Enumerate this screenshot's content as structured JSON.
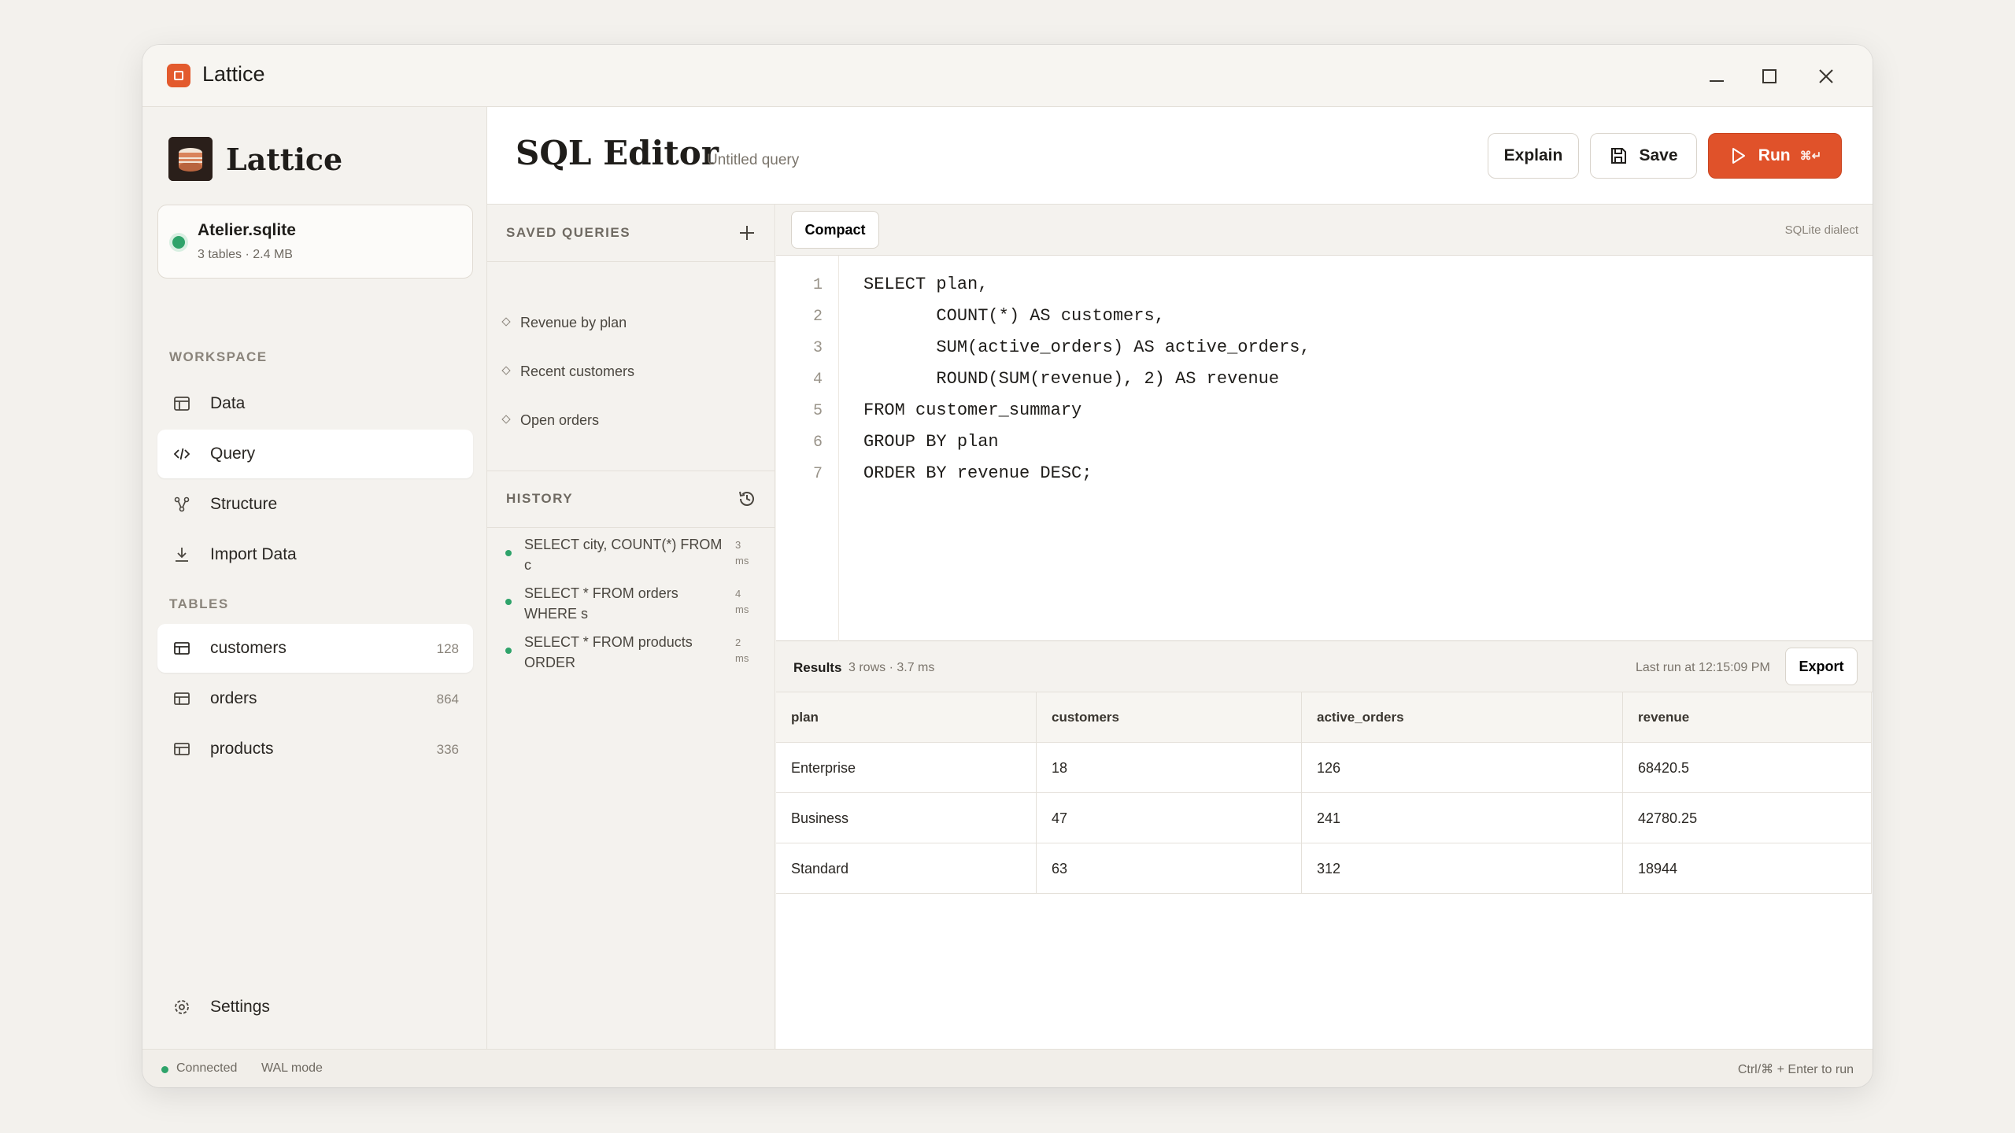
{
  "window": {
    "title": "Lattice"
  },
  "sidebar": {
    "brand": "Lattice",
    "database": {
      "name": "Atelier.sqlite",
      "meta": "3 tables · 2.4 MB"
    },
    "workspace_label": "WORKSPACE",
    "workspace_items": [
      {
        "label": "Data",
        "icon": "table-icon"
      },
      {
        "label": "Query",
        "icon": "code-icon",
        "active": true
      },
      {
        "label": "Structure",
        "icon": "schema-icon"
      },
      {
        "label": "Import Data",
        "icon": "download-icon"
      }
    ],
    "tables_label": "TABLES",
    "tables": [
      {
        "label": "customers",
        "count": "128"
      },
      {
        "label": "orders",
        "count": "864"
      },
      {
        "label": "products",
        "count": "336"
      }
    ],
    "settings_label": "Settings"
  },
  "header": {
    "title": "SQL Editor",
    "subtitle": "Untitled query",
    "explain_label": "Explain",
    "save_label": "Save",
    "run_label": "Run",
    "run_shortcut": "⌘↵"
  },
  "saved_queries": {
    "label": "SAVED QUERIES",
    "items": [
      "Revenue by plan",
      "Recent customers",
      "Open orders"
    ]
  },
  "history": {
    "label": "HISTORY",
    "items": [
      {
        "query": "SELECT city, COUNT(*) FROM c",
        "time": "3 ms"
      },
      {
        "query": "SELECT * FROM orders WHERE s",
        "time": "4 ms"
      },
      {
        "query": "SELECT * FROM products ORDER",
        "time": "2 ms"
      }
    ]
  },
  "editor": {
    "mode_chip": "Compact",
    "dialect": "SQLite dialect",
    "lines": [
      "SELECT plan,",
      "       COUNT(*) AS customers,",
      "       SUM(active_orders) AS active_orders,",
      "       ROUND(SUM(revenue), 2) AS revenue",
      "FROM customer_summary",
      "GROUP BY plan",
      "ORDER BY revenue DESC;"
    ],
    "line_numbers": [
      "1",
      "2",
      "3",
      "4",
      "5",
      "6",
      "7"
    ]
  },
  "results": {
    "label": "Results",
    "meta": "3 rows · 3.7 ms",
    "last_run": "Last run at 12:15:09 PM",
    "export_label": "Export",
    "columns": [
      "plan",
      "customers",
      "active_orders",
      "revenue"
    ],
    "rows": [
      [
        "Enterprise",
        "18",
        "126",
        "68420.5"
      ],
      [
        "Business",
        "47",
        "241",
        "42780.25"
      ],
      [
        "Standard",
        "63",
        "312",
        "18944"
      ]
    ]
  },
  "status": {
    "connected": "Connected",
    "mode": "WAL mode",
    "hint": "Ctrl/⌘ + Enter to run"
  },
  "colors": {
    "accent": "#e0522a",
    "success": "#2ea36a"
  }
}
